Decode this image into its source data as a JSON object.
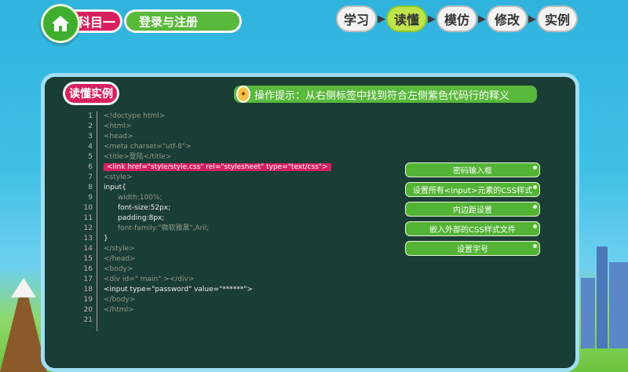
{
  "header": {
    "subject_label": "科目一",
    "title": "登录与注册"
  },
  "nav": {
    "items": [
      {
        "label": "学习",
        "active": false
      },
      {
        "label": "读懂",
        "active": true
      },
      {
        "label": "模仿",
        "active": false
      },
      {
        "label": "修改",
        "active": false
      },
      {
        "label": "实例",
        "active": false
      }
    ]
  },
  "panel": {
    "badge": "读懂实例",
    "hint": "操作提示：从右侧标签中找到符合左侧紫色代码行的释义"
  },
  "code_lines": [
    {
      "num": "1",
      "text": "<!doctype html>",
      "style": "dim"
    },
    {
      "num": "2",
      "text": "<html>",
      "style": "dim"
    },
    {
      "num": "3",
      "text": "<head>",
      "style": "dim"
    },
    {
      "num": "4",
      "text": "<meta charset=\"utf-8\">",
      "style": "dim"
    },
    {
      "num": "5",
      "text": "<title>登陆</title>",
      "style": "dim"
    },
    {
      "num": "6",
      "text": "<link href=\"style/style.css\" rel=\"stylesheet\" type=\"text/css\">",
      "style": "highlight"
    },
    {
      "num": "7",
      "text": "<style>",
      "style": "dim"
    },
    {
      "num": "8",
      "text": "input{",
      "style": "white"
    },
    {
      "num": "9",
      "text": "width:100%;",
      "style": "dim-indent"
    },
    {
      "num": "10",
      "text": "font-size:52px;",
      "style": "white-indent"
    },
    {
      "num": "11",
      "text": "padding:8px;",
      "style": "white-indent"
    },
    {
      "num": "12",
      "text": "font-family:\"微软雅黑\",Aril;",
      "style": "dim-indent"
    },
    {
      "num": "13",
      "text": "}",
      "style": "white"
    },
    {
      "num": "14",
      "text": "</style>",
      "style": "dim"
    },
    {
      "num": "15",
      "text": "</head>",
      "style": "dim"
    },
    {
      "num": "16",
      "text": "<body>",
      "style": "dim"
    },
    {
      "num": "17",
      "text": "<div id=\"  main\" ></div>",
      "style": "dim"
    },
    {
      "num": "18",
      "text": "<input type=\"password\" value=\"******\">",
      "style": "white"
    },
    {
      "num": "19",
      "text": "</body>",
      "style": "dim"
    },
    {
      "num": "20",
      "text": "</html>",
      "style": "dim"
    },
    {
      "num": "21",
      "text": "",
      "style": "dim"
    }
  ],
  "options": [
    "密码输入框",
    "设置所有<input>元素的CSS样式",
    "内边距设置",
    "嵌入外部的CSS样式文件",
    "设置字号"
  ]
}
